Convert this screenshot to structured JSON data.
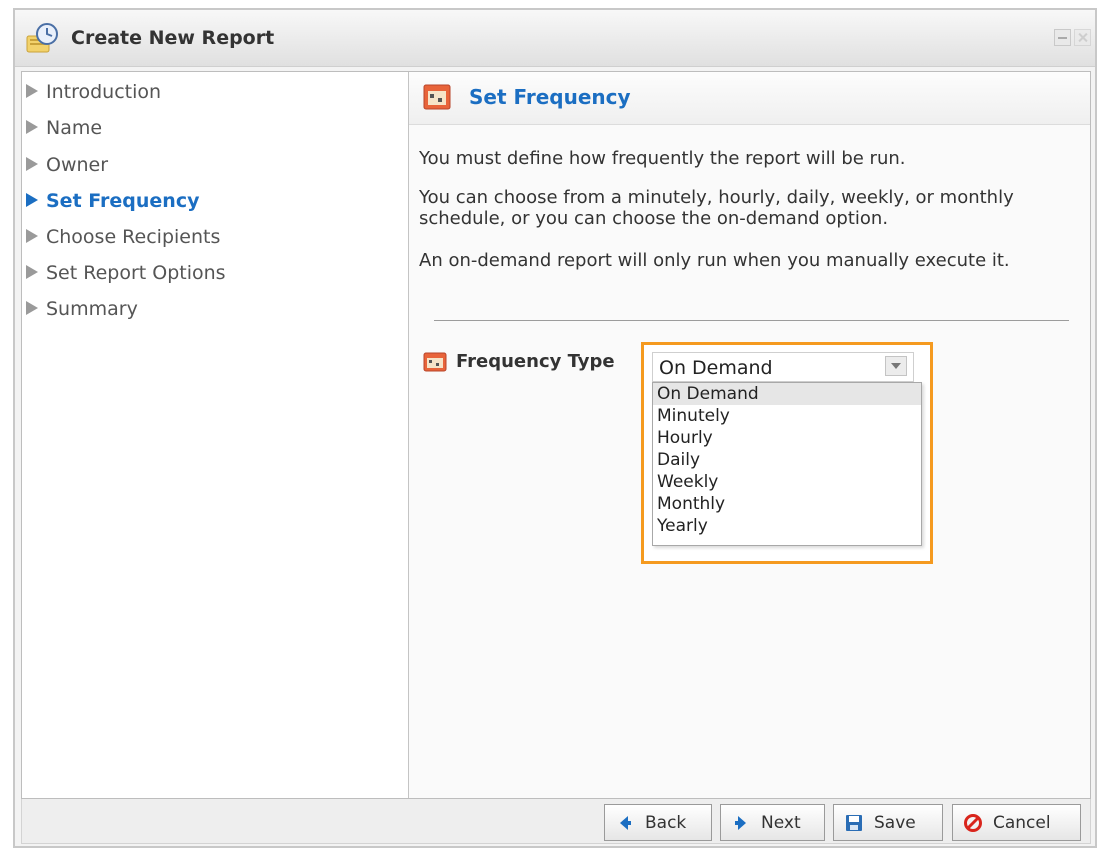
{
  "window": {
    "title": "Create New Report"
  },
  "sidebar": {
    "items": [
      {
        "label": "Introduction",
        "active": false
      },
      {
        "label": "Name",
        "active": false
      },
      {
        "label": "Owner",
        "active": false
      },
      {
        "label": "Set Frequency",
        "active": true
      },
      {
        "label": "Choose Recipients",
        "active": false
      },
      {
        "label": "Set Report Options",
        "active": false
      },
      {
        "label": "Summary",
        "active": false
      }
    ]
  },
  "panel": {
    "title": "Set Frequency",
    "paragraphs": [
      "You must define how frequently the report will be run.",
      "You can choose from a minutely, hourly, daily, weekly, or monthly schedule, or you can choose the on-demand option.",
      "An on-demand report will only run when you manually execute it."
    ],
    "field_label": "Frequency Type",
    "select": {
      "value": "On Demand",
      "options": [
        "On Demand",
        "Minutely",
        "Hourly",
        "Daily",
        "Weekly",
        "Monthly",
        "Yearly"
      ],
      "highlighted": "On Demand"
    }
  },
  "footer": {
    "back": "Back",
    "next": "Next",
    "save": "Save",
    "cancel": "Cancel"
  },
  "colors": {
    "accent": "#1b6ec2",
    "highlight_border": "#f59a1f"
  }
}
